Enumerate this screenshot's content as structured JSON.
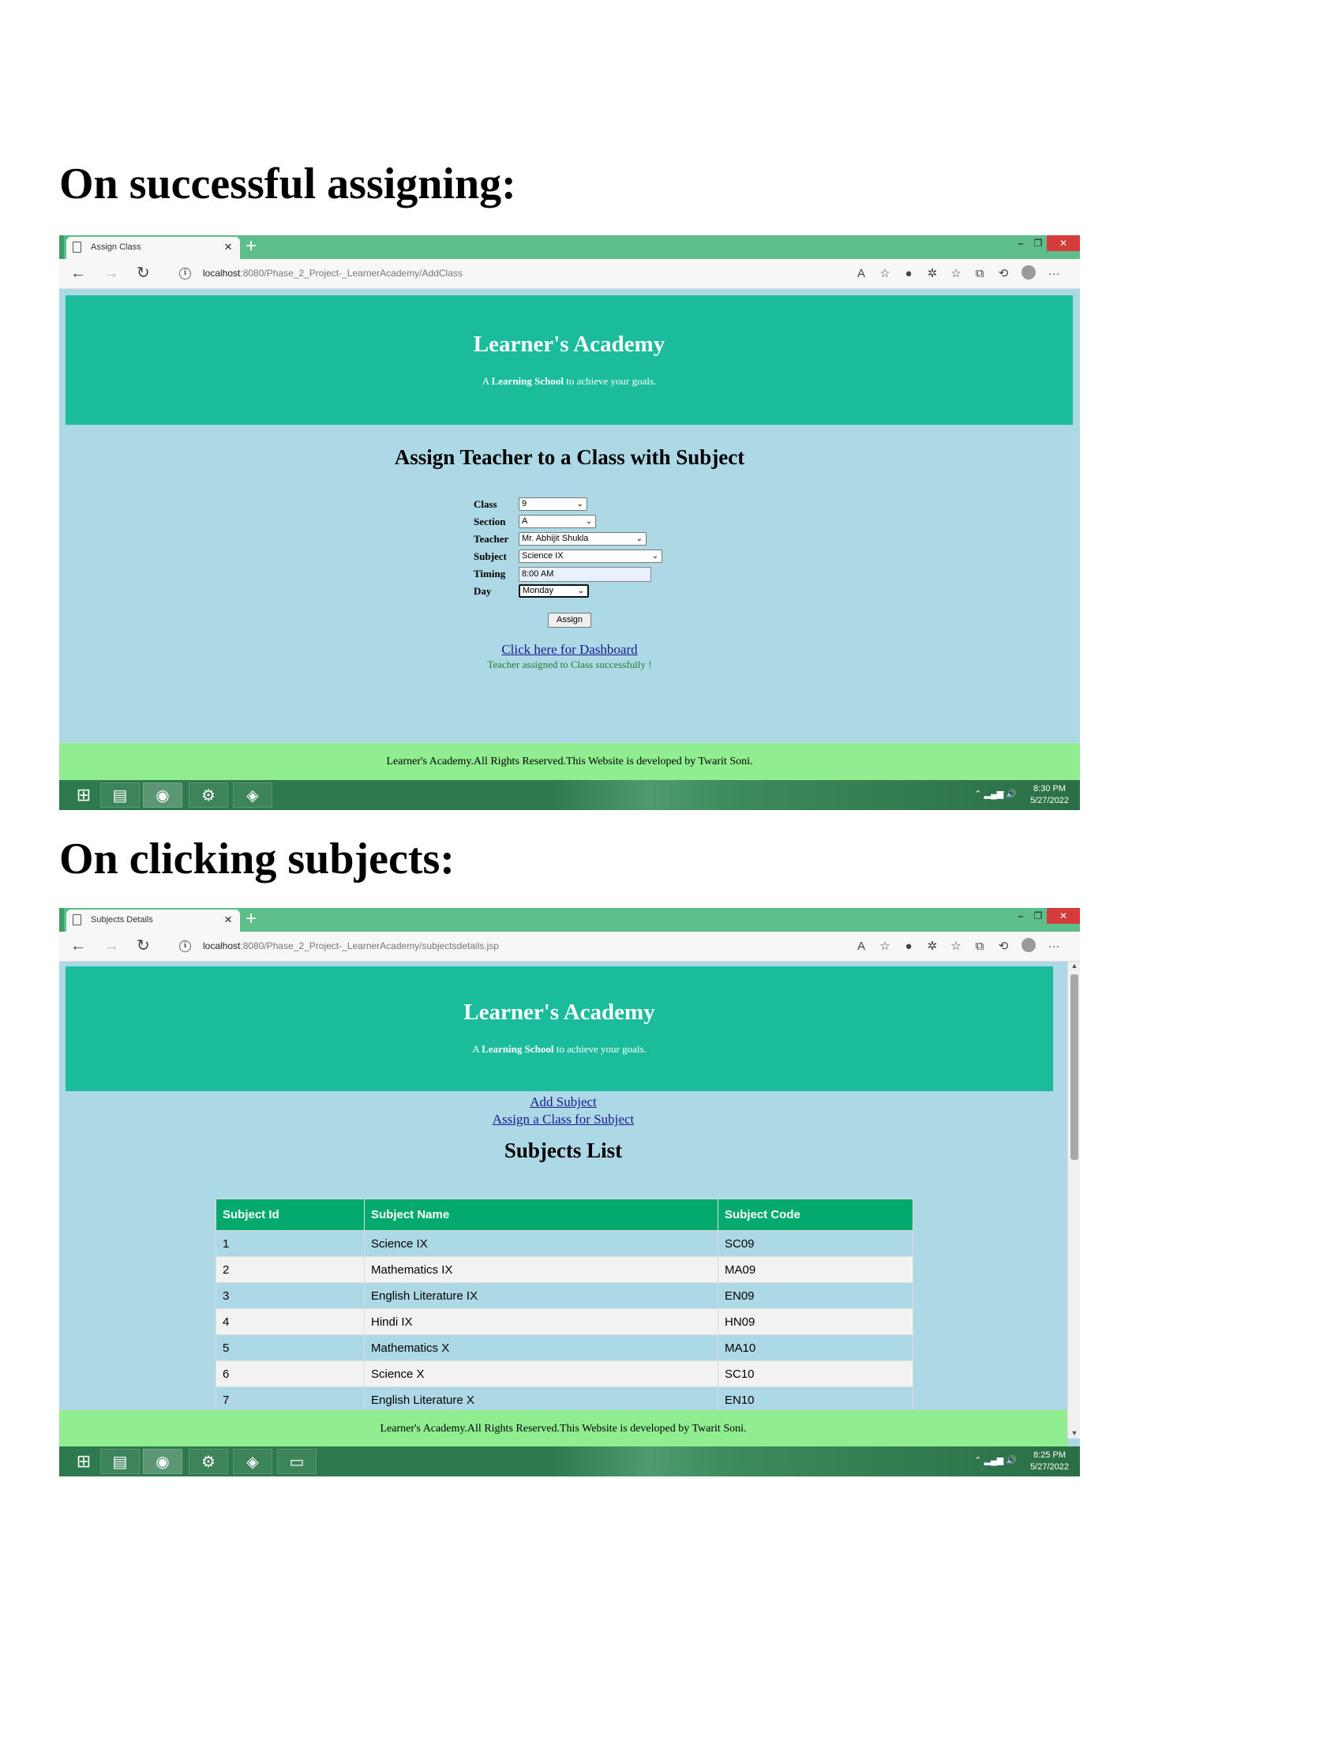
{
  "headings": {
    "first": "On successful assigning:",
    "second": "On clicking subjects:"
  },
  "browser1": {
    "tab_title": "Assign Class",
    "url_host": "localhost",
    "url_rest": ":8080/Phase_2_Project-_LearnerAcademy/AddClass"
  },
  "browser2": {
    "tab_title": "Subjects Details",
    "url_host": "localhost",
    "url_rest": ":8080/Phase_2_Project-_LearnerAcademy/subjectsdetails.jsp"
  },
  "site": {
    "name": "Learner's Academy",
    "tagline_pre": "A ",
    "tagline_bold": "Learning School",
    "tagline_post": " to achieve your goals.",
    "footer": "Learner's Academy.All Rights Reserved.This Website is developed by Twarit Soni."
  },
  "assign": {
    "title": "Assign Teacher to a Class with Subject",
    "fields": {
      "class_label": "Class",
      "class_value": "9",
      "section_label": "Section",
      "section_value": "A",
      "teacher_label": "Teacher",
      "teacher_value": "Mr. Abhijit Shukla",
      "subject_label": "Subject",
      "subject_value": "Science IX",
      "timing_label": "Timing",
      "timing_value": "8:00 AM",
      "day_label": "Day",
      "day_value": "Monday"
    },
    "button": "Assign",
    "dashboard_link": "Click here for Dashboard",
    "success": "Teacher assigned to Class successfully !"
  },
  "subjects": {
    "link_add": "Add Subject",
    "link_assign": "Assign a Class for Subject",
    "title": "Subjects List",
    "columns": [
      "Subject Id",
      "Subject Name",
      "Subject Code"
    ],
    "rows": [
      [
        "1",
        "Science IX",
        "SC09"
      ],
      [
        "2",
        "Mathematics IX",
        "MA09"
      ],
      [
        "3",
        "English Literature IX",
        "EN09"
      ],
      [
        "4",
        "Hindi IX",
        "HN09"
      ],
      [
        "5",
        "Mathematics X",
        "MA10"
      ],
      [
        "6",
        "Science X",
        "SC10"
      ],
      [
        "7",
        "English Literature X",
        "EN10"
      ]
    ]
  },
  "taskbar1": {
    "time": "8:30 PM",
    "date": "5/27/2022"
  },
  "taskbar2": {
    "time": "8:25 PM",
    "date": "5/27/2022"
  }
}
